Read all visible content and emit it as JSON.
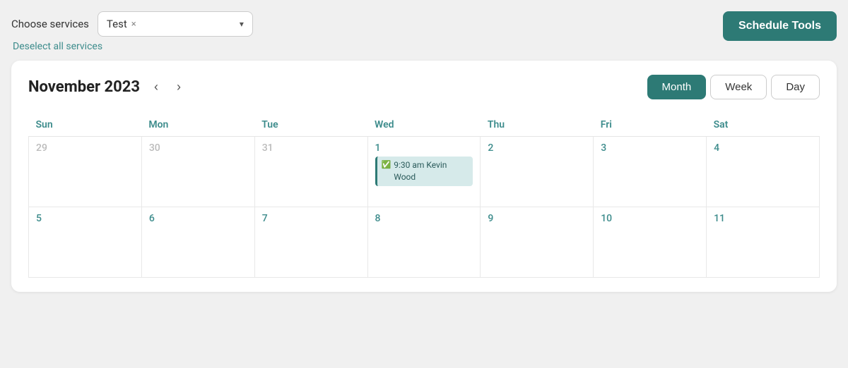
{
  "header": {
    "choose_services_label": "Choose services",
    "selected_service": "Test",
    "remove_service_label": "×",
    "chevron": "▾",
    "deselect_all_label": "Deselect all services",
    "schedule_tools_label": "Schedule Tools"
  },
  "calendar": {
    "title": "November 2023",
    "view_buttons": [
      {
        "id": "month",
        "label": "Month",
        "active": true
      },
      {
        "id": "week",
        "label": "Week",
        "active": false
      },
      {
        "id": "day",
        "label": "Day",
        "active": false
      }
    ],
    "weekdays": [
      "Sun",
      "Mon",
      "Tue",
      "Wed",
      "Thu",
      "Fri",
      "Sat"
    ],
    "weeks": [
      {
        "days": [
          {
            "number": "29",
            "muted": true,
            "events": []
          },
          {
            "number": "30",
            "muted": true,
            "events": []
          },
          {
            "number": "31",
            "muted": true,
            "events": []
          },
          {
            "number": "1",
            "muted": false,
            "events": [
              {
                "time": "9:30 am",
                "name": "Kevin Wood"
              }
            ]
          },
          {
            "number": "2",
            "muted": false,
            "events": []
          },
          {
            "number": "3",
            "muted": false,
            "events": []
          },
          {
            "number": "4",
            "muted": false,
            "events": []
          }
        ]
      },
      {
        "days": [
          {
            "number": "5",
            "muted": false,
            "events": []
          },
          {
            "number": "6",
            "muted": false,
            "events": []
          },
          {
            "number": "7",
            "muted": false,
            "events": []
          },
          {
            "number": "8",
            "muted": false,
            "events": []
          },
          {
            "number": "9",
            "muted": false,
            "events": []
          },
          {
            "number": "10",
            "muted": false,
            "events": []
          },
          {
            "number": "11",
            "muted": false,
            "events": []
          }
        ]
      }
    ]
  }
}
